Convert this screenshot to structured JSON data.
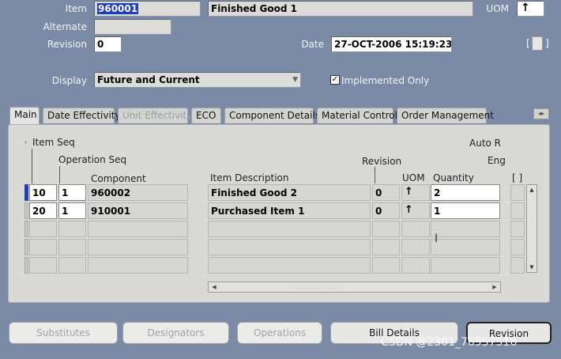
{
  "header": {
    "item_label": "Item",
    "item_value": "960001",
    "item_description": "Finished Good 1",
    "uom_label": "UOM",
    "uom_icon": "up-arrow-icon",
    "alternate_label": "Alternate",
    "alternate_value": "",
    "revision_label": "Revision",
    "revision_value": "0",
    "date_label": "Date",
    "date_value": "27-OCT-2006 15:19:23",
    "bracket_left": "[",
    "bracket_right": "]",
    "display_label": "Display",
    "display_value": "Future and Current",
    "implemented_only_label": "Implemented Only",
    "implemented_only_checked": true
  },
  "tabs": [
    {
      "label": "Main",
      "active": true,
      "disabled": false
    },
    {
      "label": "Date Effectivity",
      "active": false,
      "disabled": false
    },
    {
      "label": "Unit Effectivity",
      "active": false,
      "disabled": true
    },
    {
      "label": "ECO",
      "active": false,
      "disabled": false
    },
    {
      "label": "Component Details",
      "active": false,
      "disabled": false
    },
    {
      "label": "Material Control",
      "active": false,
      "disabled": false
    },
    {
      "label": "Order Management",
      "active": false,
      "disabled": false
    }
  ],
  "grid": {
    "headers": {
      "item_seq": "Item Seq",
      "operation_seq": "Operation Seq",
      "component": "Component",
      "auto_request": "Auto R",
      "eng": "Eng",
      "item_description": "Item Description",
      "revision": "Revision",
      "uom": "UOM",
      "quantity": "Quantity",
      "bracket": "[ ]"
    },
    "rows": [
      {
        "item_seq": "10",
        "operation_seq": "1",
        "component": "960002",
        "description": "Finished Good 2",
        "revision": "0",
        "uom": "↑",
        "quantity": "2"
      },
      {
        "item_seq": "20",
        "operation_seq": "1",
        "component": "910001",
        "description": "Purchased Item 1",
        "revision": "0",
        "uom": "↑",
        "quantity": "1"
      }
    ]
  },
  "buttons": [
    {
      "label": "Substitutes",
      "disabled": true
    },
    {
      "label": "Designators",
      "disabled": true
    },
    {
      "label": "Operations",
      "disabled": true
    },
    {
      "label": "Bill Details",
      "disabled": false
    },
    {
      "label": "Revision",
      "disabled": false,
      "default": true
    }
  ],
  "watermark": "CSDN @2301_76957516",
  "colors": {
    "background": "#7b8ba6",
    "selected_text": "#1f3fbf",
    "panel": "#d9d9d6"
  }
}
